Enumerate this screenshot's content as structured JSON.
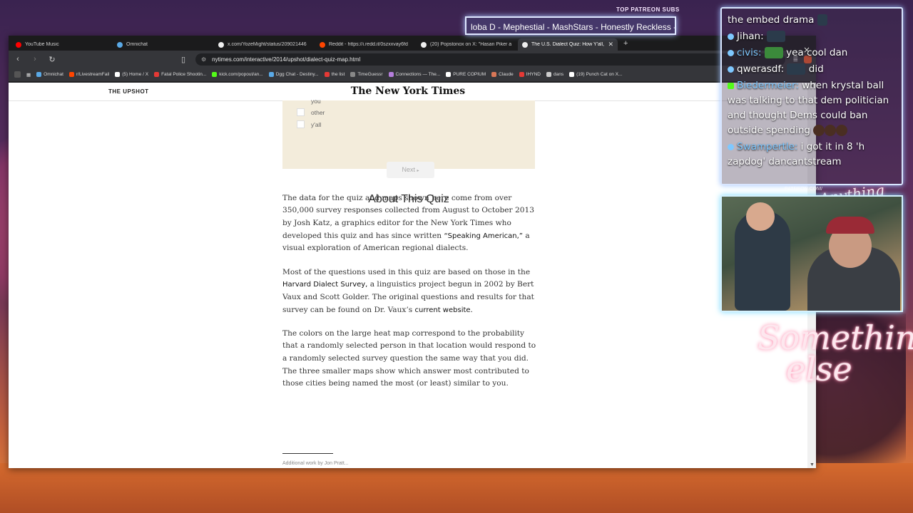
{
  "browser": {
    "tabs": [
      {
        "label": "YouTube Music",
        "color": "#ff0000",
        "active": false
      },
      {
        "label": "Omnichat",
        "color": "#5aa9e6",
        "active": false
      },
      {
        "label": "x.com/YozeMight/status/209021446",
        "color": "#ffffff",
        "active": false
      },
      {
        "label": "Reddit - https://i.redd.it/0szxxvay6fd",
        "color": "#ff4500",
        "active": false
      },
      {
        "label": "(20) Popstonox on X: \"Hasan Piker a",
        "color": "#ffffff",
        "active": false
      },
      {
        "label": "The U.S. Dialect Quiz: How Y'all, ",
        "color": "#ffffff",
        "active": true
      }
    ],
    "url": "nytimes.com/interactive/2014/upshot/dialect-quiz-map.html",
    "bookmarks": [
      {
        "label": "Omnichat",
        "color": "#5aa9e6"
      },
      {
        "label": "r/LivestreamFail",
        "color": "#ff4500"
      },
      {
        "label": "(5) Home / X",
        "color": "#ffffff"
      },
      {
        "label": "Fatal Police Shootin...",
        "color": "#e53935"
      },
      {
        "label": "kick.com/popout/an...",
        "color": "#53fc18"
      },
      {
        "label": "Dgg Chat - Destiny...",
        "color": "#5aa9e6"
      },
      {
        "label": "the list",
        "color": "#e53935"
      },
      {
        "label": "TimeGuessr",
        "color": "#888888"
      },
      {
        "label": "Connections — The...",
        "color": "#b57edc"
      },
      {
        "label": "PURE COPIUM",
        "color": "#ffffff"
      },
      {
        "label": "Claude",
        "color": "#d97757"
      },
      {
        "label": "IHYND",
        "color": "#e53935"
      },
      {
        "label": "dans",
        "color": "#cccccc"
      },
      {
        "label": "(19) Punch Cat on X...",
        "color": "#ffffff"
      }
    ]
  },
  "nyt": {
    "section": "THE UPSHOT",
    "masthead": "The New York Times",
    "options": [
      "you",
      "other",
      "y'all"
    ],
    "next_label": "Next",
    "about_title": "About This Quiz",
    "para1_a": "The data for the quiz and maps shown here come from over 350,000 survey responses collected from August to October 2013 by Josh Katz, a graphics editor for the New York Times who developed this quiz and has since written ",
    "para1_link": "“Speaking American,”",
    "para1_b": " a visual exploration of American regional dialects.",
    "para2_a": "Most of the questions used in this quiz are based on those in the ",
    "para2_link1": "Harvard Dialect Survey,",
    "para2_b": " a linguistics project begun in 2002 by Bert Vaux and Scott Golder. The original questions and results for that survey can be found on Dr. Vaux’s ",
    "para2_link2": "current website.",
    "para3": "The colors on the large heat map correspond to the probability that a randomly selected person in that location would respond to a randomly selected survey question the same way that you did. The three smaller maps show which answer most contributed to those cities being named the most (or least) similar to you.",
    "footnote": "Additional work by Jon Pratt..."
  },
  "stream": {
    "ticker_label": "TOP PATREON SUBS",
    "ticker_text": "loba D - Mephestial - MashStars - Honestly Reckless - Mo",
    "chat": [
      {
        "user": "",
        "text": "the embed drama"
      },
      {
        "user": "Jihan:",
        "text": ""
      },
      {
        "user": "civis:",
        "text": "yea cool dan"
      },
      {
        "user": "qwerasdf:",
        "text": "did"
      },
      {
        "user": "Biedermeier:",
        "text": "when krystal ball was talking to that dem politician and thought Dems could ban outside spending"
      },
      {
        "user": "Swampertle:",
        "text": "i got it in 8 'h zapdog' dancantstream"
      }
    ],
    "patreon_label": "PATREON.COM/",
    "cam_script": "Anything else",
    "brand_line1": "Something",
    "brand_line2": "else"
  }
}
